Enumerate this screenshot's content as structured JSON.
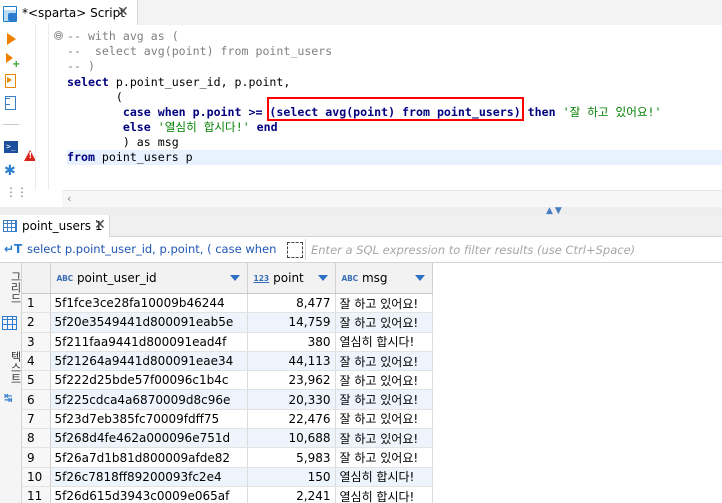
{
  "editor": {
    "tab_title": "*<sparta> Script",
    "close_glyph": "✕",
    "toolbar_icons": [
      "execute-statement-icon",
      "execute-in-new-tab-icon",
      "execute-script-icon",
      "explain-plan-icon",
      "output-console-icon",
      "settings-icon",
      "more-icon"
    ],
    "fold_glyph": "⊖",
    "error_glyph": "!"
  },
  "code": {
    "l1": "-- with avg as (",
    "l2": "--  select avg(point) from point_users",
    "l3": "-- )",
    "l4_kw1": "select",
    "l4_rest": " p.point_user_id, p.point,",
    "l5": "       (",
    "l6_a": "        case when p.point >= ",
    "l6_sub": "(select avg(point) from point_users)",
    "l6_b": " then ",
    "l6_str": "'잘 하고 있어요!'",
    "l7_a": "        else ",
    "l7_str": "'열심히 합시다!'",
    "l7_b": " end",
    "l8": "        ) as msg",
    "l9_kw": "from",
    "l9_rest": " point_users p",
    "error_line_indicator_icon": "error-icon"
  },
  "results": {
    "tab_label": "point_users 1",
    "close_glyph": "✕",
    "filter_query": "select p.point_user_id, p.point, ( case when p.p",
    "filter_placeholder": "Enter a SQL expression to filter results (use Ctrl+Space)",
    "side_tab_grid": "그리드",
    "side_tab_text": "텍스트",
    "columns": [
      {
        "name": "point_user_id",
        "type_badge": "ABC"
      },
      {
        "name": "point",
        "type_badge": "123"
      },
      {
        "name": "msg",
        "type_badge": "ABC"
      }
    ],
    "rows": [
      {
        "n": "1",
        "id": "5f1fce3ce28fa10009b46244",
        "point": "8,477",
        "msg": "잘 하고 있어요!"
      },
      {
        "n": "2",
        "id": "5f20e3549441d800091eab5e",
        "point": "14,759",
        "msg": "잘 하고 있어요!"
      },
      {
        "n": "3",
        "id": "5f211faa9441d800091ead4f",
        "point": "380",
        "msg": "열심히 합시다!"
      },
      {
        "n": "4",
        "id": "5f21264a9441d800091eae34",
        "point": "44,113",
        "msg": "잘 하고 있어요!"
      },
      {
        "n": "5",
        "id": "5f222d25bde57f00096c1b4c",
        "point": "23,962",
        "msg": "잘 하고 있어요!"
      },
      {
        "n": "6",
        "id": "5f225cdca4a6870009d8c96e",
        "point": "20,330",
        "msg": "잘 하고 있어요!"
      },
      {
        "n": "7",
        "id": "5f23d7eb385fc70009fdff75",
        "point": "22,476",
        "msg": "잘 하고 있어요!"
      },
      {
        "n": "8",
        "id": "5f268d4fe462a000096e751d",
        "point": "10,688",
        "msg": "잘 하고 있어요!"
      },
      {
        "n": "9",
        "id": "5f26a7d1b81d800009afde82",
        "point": "5,983",
        "msg": "잘 하고 있어요!"
      },
      {
        "n": "10",
        "id": "5f26c7818ff89200093fc2e4",
        "point": "150",
        "msg": "열심히 합시다!"
      },
      {
        "n": "11",
        "id": "5f26d615d3943c0009e065af",
        "point": "2,241",
        "msg": "열심히 합시다!"
      }
    ]
  },
  "colors": {
    "accent_blue": "#2d6fc2",
    "highlight_box": "#ff0000",
    "keyword": "#000080",
    "string": "#008000",
    "comment": "#808080",
    "row_alt": "#eef4fc"
  }
}
